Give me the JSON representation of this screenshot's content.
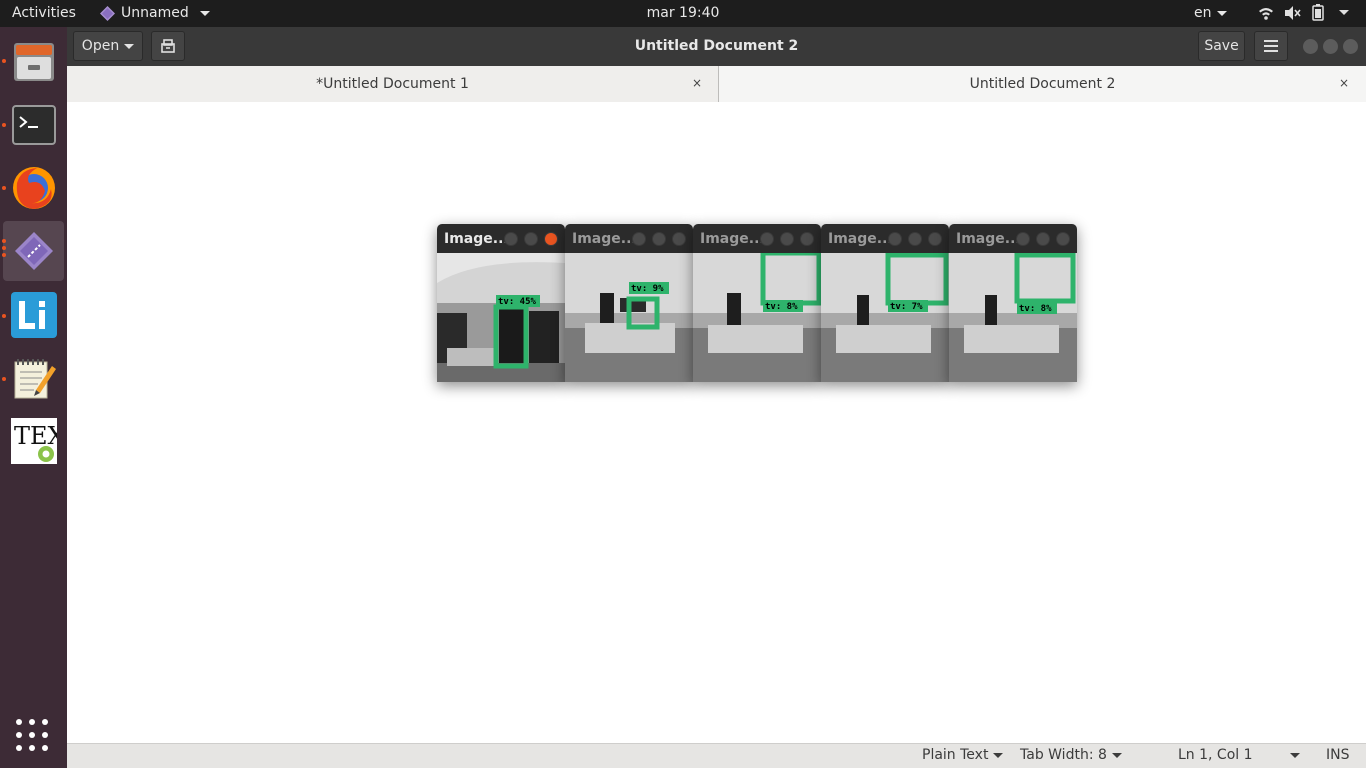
{
  "topbar": {
    "activities": "Activities",
    "app_name": "Unnamed",
    "clock": "mar 19:40",
    "lang": "en"
  },
  "dock": {
    "items": [
      "files",
      "terminal",
      "firefox",
      "gedit-diamond",
      "libreoffice-writer",
      "text-editor",
      "texmaker"
    ]
  },
  "header": {
    "open_label": "Open",
    "title": "Untitled Document 2",
    "save_label": "Save"
  },
  "tabs": [
    {
      "label": "*Untitled Document 1"
    },
    {
      "label": "Untitled Document 2"
    }
  ],
  "tab_close_glyph": "×",
  "statusbar": {
    "language": "Plain Text",
    "tab_width": "Tab Width: 8",
    "cursor": "Ln 1, Col 1",
    "mode": "INS"
  },
  "image_windows": [
    {
      "title": "Image...",
      "label": "tv: 45%"
    },
    {
      "title": "Image...",
      "label": "tv: 9%"
    },
    {
      "title": "Image...",
      "label": "tv: 8%"
    },
    {
      "title": "Image...",
      "label": "tv: 7%"
    },
    {
      "title": "Image...",
      "label": "tv: 8%"
    }
  ],
  "colors": {
    "accent": "#e95420",
    "dock_bg": "#3d2b36",
    "detection_box": "#2eb36b"
  }
}
